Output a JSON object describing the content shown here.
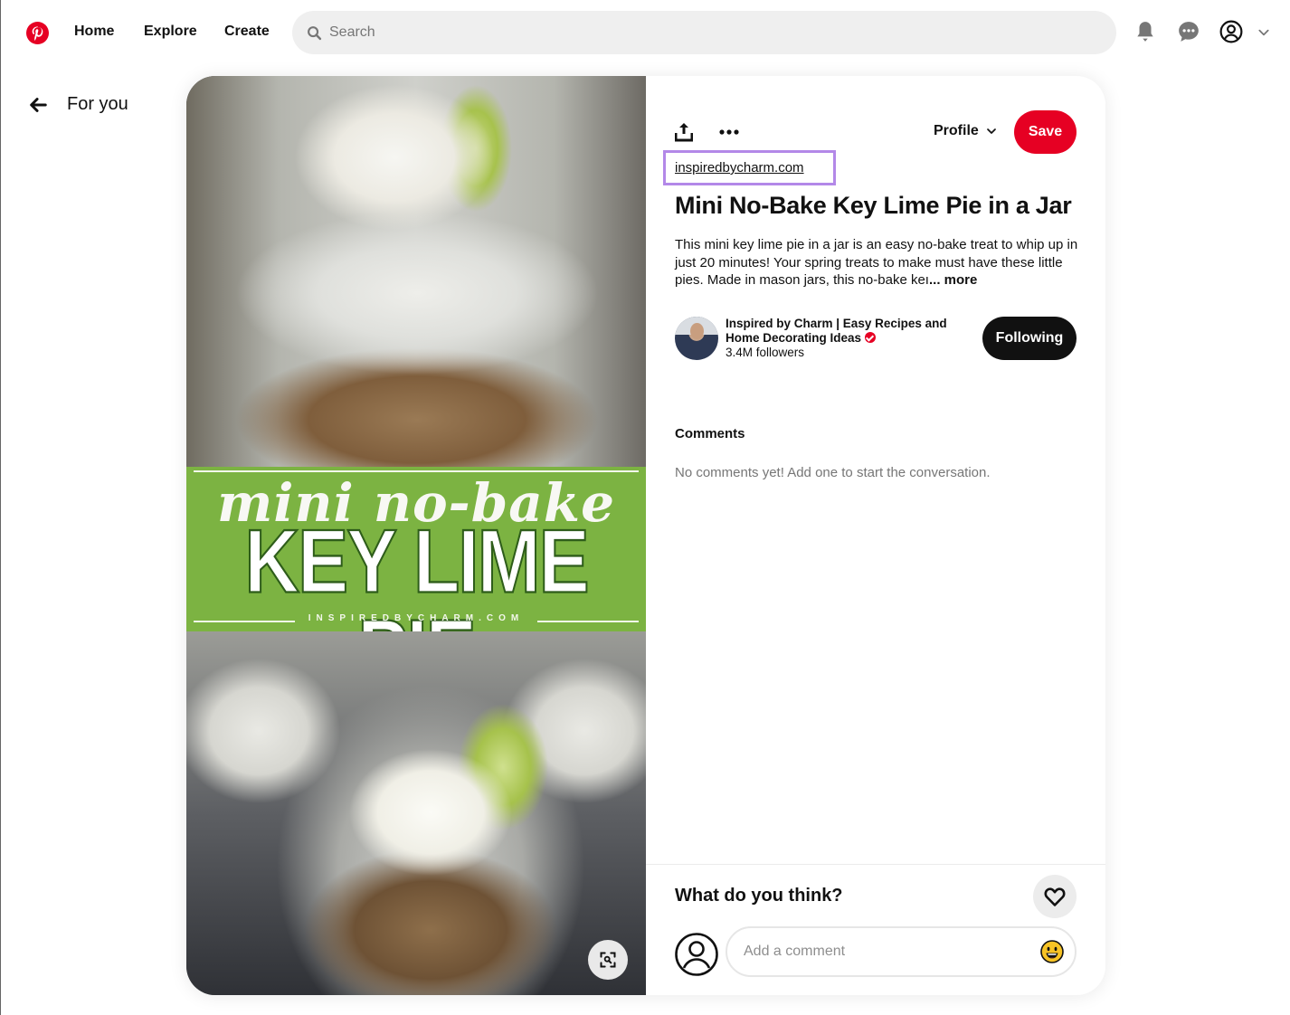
{
  "header": {
    "logo": "pinterest-logo",
    "nav": [
      {
        "label": "Home"
      },
      {
        "label": "Explore"
      },
      {
        "label": "Create"
      }
    ],
    "search": {
      "placeholder": "Search",
      "value": ""
    },
    "icons": [
      "bell-icon",
      "chat-icon",
      "account-icon",
      "chevron-down-icon"
    ]
  },
  "back": {
    "label": "For you"
  },
  "pin": {
    "image": {
      "overlay_script": "mini no-bake",
      "overlay_title": "KEY LIME PIE",
      "overlay_site": "INSPIREDBYCHARM.COM",
      "band_color": "#7cb342"
    },
    "actions": {
      "profile_label": "Profile",
      "save_label": "Save"
    },
    "source_link": "inspiredbycharm.com",
    "title": "Mini No-Bake Key Lime Pie in a Jar",
    "description": "This mini key lime pie in a jar is an easy no-bake treat to whip up in just 20 minutes! Your spring treats to make must have these little pies. Made in mason jars, this no-bake keı",
    "description_more": "... more",
    "creator": {
      "name": "Inspired by Charm | Easy Recipes and Home Decorating Ideas",
      "verified": true,
      "followers": "3.4M followers",
      "follow_label": "Following"
    },
    "comments": {
      "heading": "Comments",
      "empty_text": "No comments yet! Add one to start the conversation."
    },
    "feedback": {
      "prompt": "What do you think?",
      "comment_placeholder": "Add a comment"
    }
  },
  "colors": {
    "brand_red": "#e60023",
    "highlight_box": "#b388e8",
    "following_bg": "#111111"
  }
}
